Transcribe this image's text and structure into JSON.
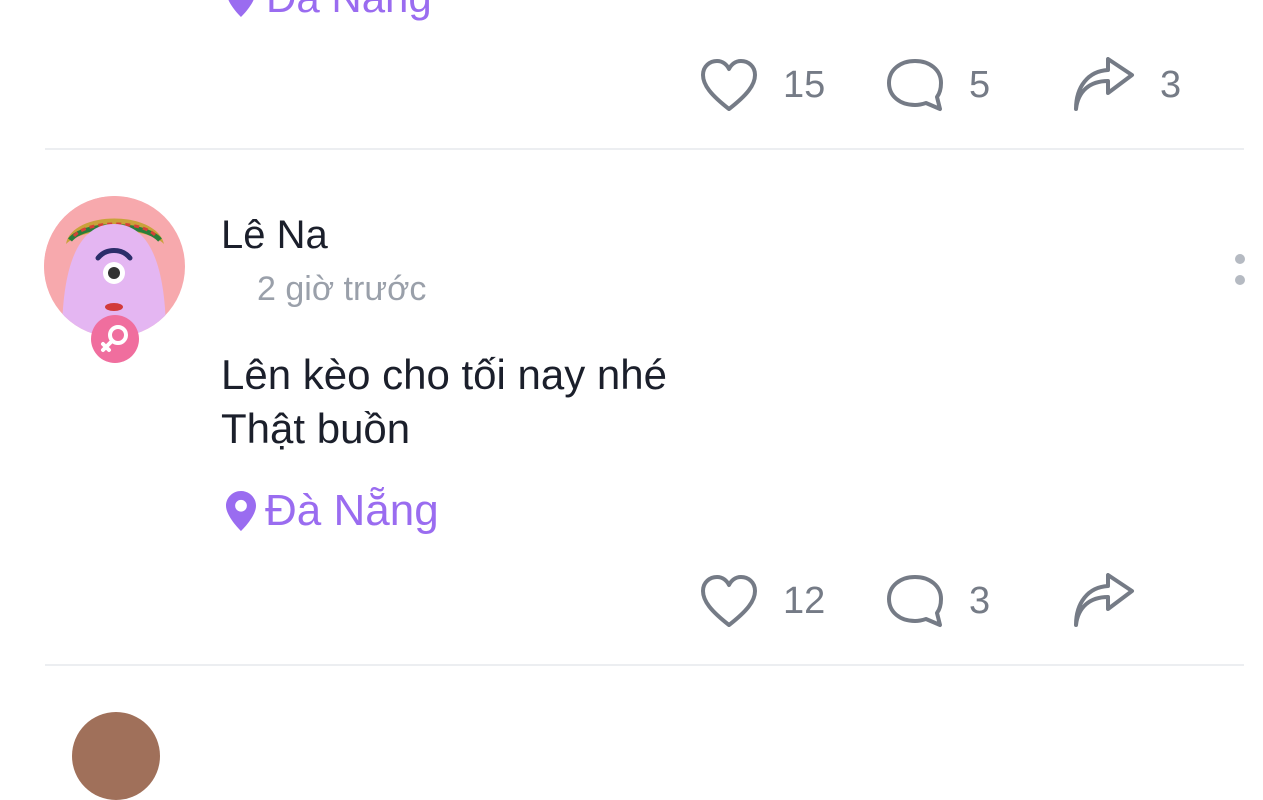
{
  "previous_post": {
    "location": "Đà Nẵng",
    "likes": "15",
    "comments": "5",
    "shares": "3"
  },
  "post": {
    "username": "Lê Na",
    "time": "2 giờ trước",
    "content_lines": [
      "Lên kèo cho tối nay nhé",
      "Thật buồn"
    ],
    "location": "Đà Nẵng",
    "likes": "12",
    "comments": "3",
    "shares": ""
  },
  "colors": {
    "accent": "#9a6cf0",
    "gender_badge": "#f06e9e",
    "muted_text": "#9aa0aa",
    "icon": "#757b86"
  },
  "icons": {
    "location": "map-pin-icon",
    "like": "heart-icon",
    "comment": "speech-bubble-icon",
    "share": "share-arrow-icon",
    "gender": "female-symbol-icon",
    "more": "vertical-dots-icon"
  }
}
